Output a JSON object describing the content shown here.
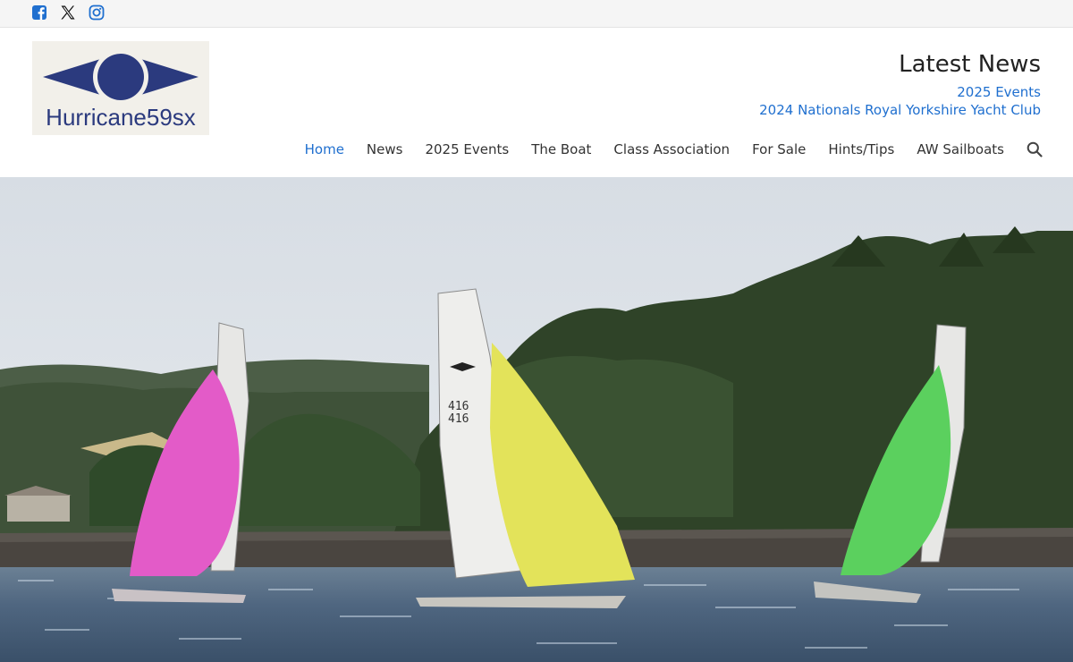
{
  "social": [
    {
      "name": "facebook-icon",
      "color": "#1f6fcf"
    },
    {
      "name": "x-icon",
      "color": "#111111"
    },
    {
      "name": "instagram-icon",
      "color": "#1f6fcf"
    }
  ],
  "logo": {
    "text": "Hurricane59sx",
    "color": "#2b3a7e"
  },
  "latest_news": {
    "title": "Latest News",
    "links": [
      "2025 Events",
      "2024 Nationals Royal Yorkshire Yacht Club"
    ]
  },
  "nav": {
    "items": [
      "Home",
      "News",
      "2025 Events",
      "The Boat",
      "Class Association",
      "For Sale",
      "Hints/Tips",
      "AW Sailboats"
    ],
    "active": "Home",
    "search_icon": "search-icon"
  },
  "hero": {
    "sail_numbers": [
      "416",
      "416"
    ]
  },
  "colors": {
    "accent": "#1f6fcf",
    "text": "#333333"
  }
}
